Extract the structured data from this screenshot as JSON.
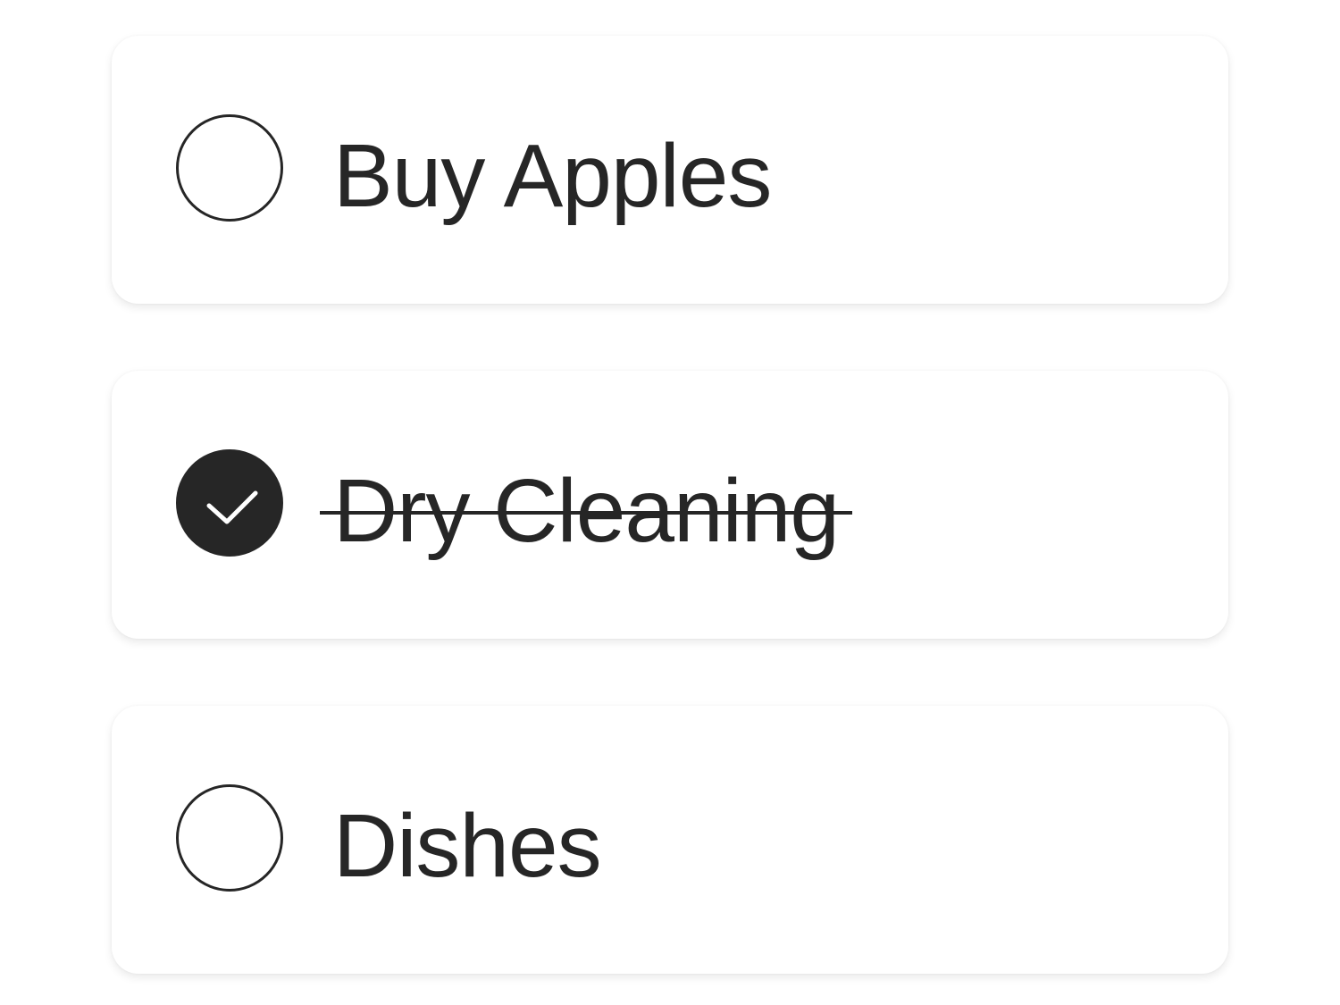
{
  "todos": [
    {
      "label": "Buy Apples",
      "completed": false
    },
    {
      "label": "Dry Cleaning",
      "completed": true
    },
    {
      "label": "Dishes",
      "completed": false
    }
  ],
  "colors": {
    "text": "#262626",
    "card_background": "#ffffff",
    "checkbox_checked_fill": "#262626",
    "checkmark": "#ffffff"
  },
  "icons": {
    "unchecked": "empty-circle-icon",
    "checked": "checkmark-circle-icon"
  }
}
